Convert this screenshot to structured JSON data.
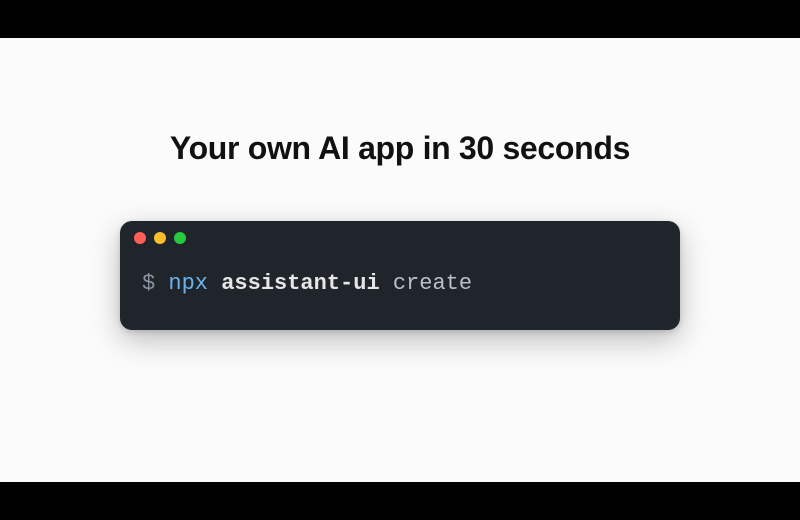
{
  "headline": "Your own AI app in 30 seconds",
  "terminal": {
    "prompt": "$",
    "binary": "npx",
    "package": "assistant-ui",
    "subcommand": "create",
    "traffic_lights": {
      "close": "close",
      "minimize": "minimize",
      "zoom": "zoom"
    }
  }
}
